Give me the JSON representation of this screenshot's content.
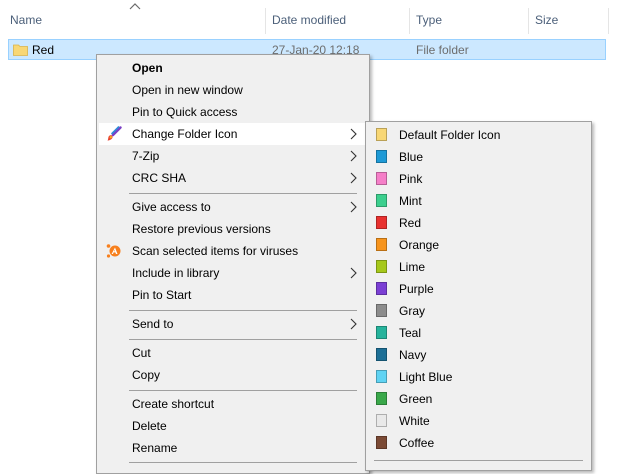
{
  "columns": {
    "name": "Name",
    "date_modified": "Date modified",
    "type": "Type",
    "size": "Size"
  },
  "file_row": {
    "name": "Red",
    "date": "27-Jan-20 12:18",
    "type": "File folder"
  },
  "context_menu": {
    "open": "Open",
    "open_new_window": "Open in new window",
    "pin_quick_access": "Pin to Quick access",
    "change_folder_icon": "Change Folder Icon",
    "seven_zip": "7-Zip",
    "crc_sha": "CRC SHA",
    "give_access": "Give access to",
    "restore_versions": "Restore previous versions",
    "scan_viruses": "Scan selected items for viruses",
    "include_library": "Include in library",
    "pin_start": "Pin to Start",
    "send_to": "Send to",
    "cut": "Cut",
    "copy": "Copy",
    "create_shortcut": "Create shortcut",
    "delete": "Delete",
    "rename": "Rename"
  },
  "folder_icon_submenu": [
    {
      "label": "Default Folder Icon",
      "color": "#f8d775"
    },
    {
      "label": "Blue",
      "color": "#1e9ad6"
    },
    {
      "label": "Pink",
      "color": "#f57fc8"
    },
    {
      "label": "Mint",
      "color": "#3ccf8e"
    },
    {
      "label": "Red",
      "color": "#e8312f"
    },
    {
      "label": "Orange",
      "color": "#f7941d"
    },
    {
      "label": "Lime",
      "color": "#a6c81a"
    },
    {
      "label": "Purple",
      "color": "#7b3fd4"
    },
    {
      "label": "Gray",
      "color": "#8c8c8c"
    },
    {
      "label": "Teal",
      "color": "#26b39c"
    },
    {
      "label": "Navy",
      "color": "#1d6f96"
    },
    {
      "label": "Light Blue",
      "color": "#5fd3f3"
    },
    {
      "label": "Green",
      "color": "#3aa84a"
    },
    {
      "label": "White",
      "color": "#e9e9e9"
    },
    {
      "label": "Coffee",
      "color": "#7b4a35"
    }
  ],
  "icons": {
    "sort": "chevron-up-icon",
    "folder": "folder-icon",
    "change_icon": "paintbrush-icon",
    "scan": "avast-icon",
    "submenu_arrow": "chevron-right-icon"
  }
}
